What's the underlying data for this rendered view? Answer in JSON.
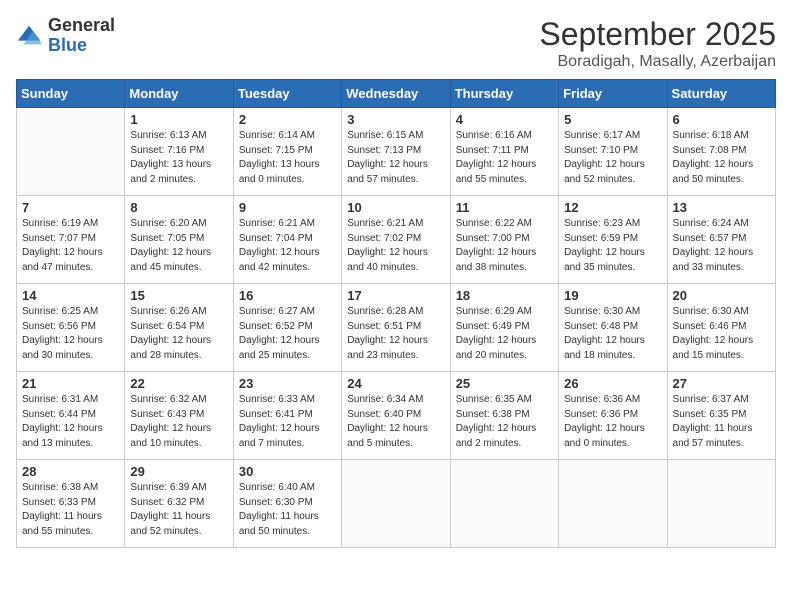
{
  "logo": {
    "general": "General",
    "blue": "Blue"
  },
  "title": "September 2025",
  "subtitle": "Boradigah, Masally, Azerbaijan",
  "days_of_week": [
    "Sunday",
    "Monday",
    "Tuesday",
    "Wednesday",
    "Thursday",
    "Friday",
    "Saturday"
  ],
  "weeks": [
    [
      {
        "day": "",
        "info": ""
      },
      {
        "day": "1",
        "info": "Sunrise: 6:13 AM\nSunset: 7:16 PM\nDaylight: 13 hours\nand 2 minutes."
      },
      {
        "day": "2",
        "info": "Sunrise: 6:14 AM\nSunset: 7:15 PM\nDaylight: 13 hours\nand 0 minutes."
      },
      {
        "day": "3",
        "info": "Sunrise: 6:15 AM\nSunset: 7:13 PM\nDaylight: 12 hours\nand 57 minutes."
      },
      {
        "day": "4",
        "info": "Sunrise: 6:16 AM\nSunset: 7:11 PM\nDaylight: 12 hours\nand 55 minutes."
      },
      {
        "day": "5",
        "info": "Sunrise: 6:17 AM\nSunset: 7:10 PM\nDaylight: 12 hours\nand 52 minutes."
      },
      {
        "day": "6",
        "info": "Sunrise: 6:18 AM\nSunset: 7:08 PM\nDaylight: 12 hours\nand 50 minutes."
      }
    ],
    [
      {
        "day": "7",
        "info": "Sunrise: 6:19 AM\nSunset: 7:07 PM\nDaylight: 12 hours\nand 47 minutes."
      },
      {
        "day": "8",
        "info": "Sunrise: 6:20 AM\nSunset: 7:05 PM\nDaylight: 12 hours\nand 45 minutes."
      },
      {
        "day": "9",
        "info": "Sunrise: 6:21 AM\nSunset: 7:04 PM\nDaylight: 12 hours\nand 42 minutes."
      },
      {
        "day": "10",
        "info": "Sunrise: 6:21 AM\nSunset: 7:02 PM\nDaylight: 12 hours\nand 40 minutes."
      },
      {
        "day": "11",
        "info": "Sunrise: 6:22 AM\nSunset: 7:00 PM\nDaylight: 12 hours\nand 38 minutes."
      },
      {
        "day": "12",
        "info": "Sunrise: 6:23 AM\nSunset: 6:59 PM\nDaylight: 12 hours\nand 35 minutes."
      },
      {
        "day": "13",
        "info": "Sunrise: 6:24 AM\nSunset: 6:57 PM\nDaylight: 12 hours\nand 33 minutes."
      }
    ],
    [
      {
        "day": "14",
        "info": "Sunrise: 6:25 AM\nSunset: 6:56 PM\nDaylight: 12 hours\nand 30 minutes."
      },
      {
        "day": "15",
        "info": "Sunrise: 6:26 AM\nSunset: 6:54 PM\nDaylight: 12 hours\nand 28 minutes."
      },
      {
        "day": "16",
        "info": "Sunrise: 6:27 AM\nSunset: 6:52 PM\nDaylight: 12 hours\nand 25 minutes."
      },
      {
        "day": "17",
        "info": "Sunrise: 6:28 AM\nSunset: 6:51 PM\nDaylight: 12 hours\nand 23 minutes."
      },
      {
        "day": "18",
        "info": "Sunrise: 6:29 AM\nSunset: 6:49 PM\nDaylight: 12 hours\nand 20 minutes."
      },
      {
        "day": "19",
        "info": "Sunrise: 6:30 AM\nSunset: 6:48 PM\nDaylight: 12 hours\nand 18 minutes."
      },
      {
        "day": "20",
        "info": "Sunrise: 6:30 AM\nSunset: 6:46 PM\nDaylight: 12 hours\nand 15 minutes."
      }
    ],
    [
      {
        "day": "21",
        "info": "Sunrise: 6:31 AM\nSunset: 6:44 PM\nDaylight: 12 hours\nand 13 minutes."
      },
      {
        "day": "22",
        "info": "Sunrise: 6:32 AM\nSunset: 6:43 PM\nDaylight: 12 hours\nand 10 minutes."
      },
      {
        "day": "23",
        "info": "Sunrise: 6:33 AM\nSunset: 6:41 PM\nDaylight: 12 hours\nand 7 minutes."
      },
      {
        "day": "24",
        "info": "Sunrise: 6:34 AM\nSunset: 6:40 PM\nDaylight: 12 hours\nand 5 minutes."
      },
      {
        "day": "25",
        "info": "Sunrise: 6:35 AM\nSunset: 6:38 PM\nDaylight: 12 hours\nand 2 minutes."
      },
      {
        "day": "26",
        "info": "Sunrise: 6:36 AM\nSunset: 6:36 PM\nDaylight: 12 hours\nand 0 minutes."
      },
      {
        "day": "27",
        "info": "Sunrise: 6:37 AM\nSunset: 6:35 PM\nDaylight: 11 hours\nand 57 minutes."
      }
    ],
    [
      {
        "day": "28",
        "info": "Sunrise: 6:38 AM\nSunset: 6:33 PM\nDaylight: 11 hours\nand 55 minutes."
      },
      {
        "day": "29",
        "info": "Sunrise: 6:39 AM\nSunset: 6:32 PM\nDaylight: 11 hours\nand 52 minutes."
      },
      {
        "day": "30",
        "info": "Sunrise: 6:40 AM\nSunset: 6:30 PM\nDaylight: 11 hours\nand 50 minutes."
      },
      {
        "day": "",
        "info": ""
      },
      {
        "day": "",
        "info": ""
      },
      {
        "day": "",
        "info": ""
      },
      {
        "day": "",
        "info": ""
      }
    ]
  ]
}
